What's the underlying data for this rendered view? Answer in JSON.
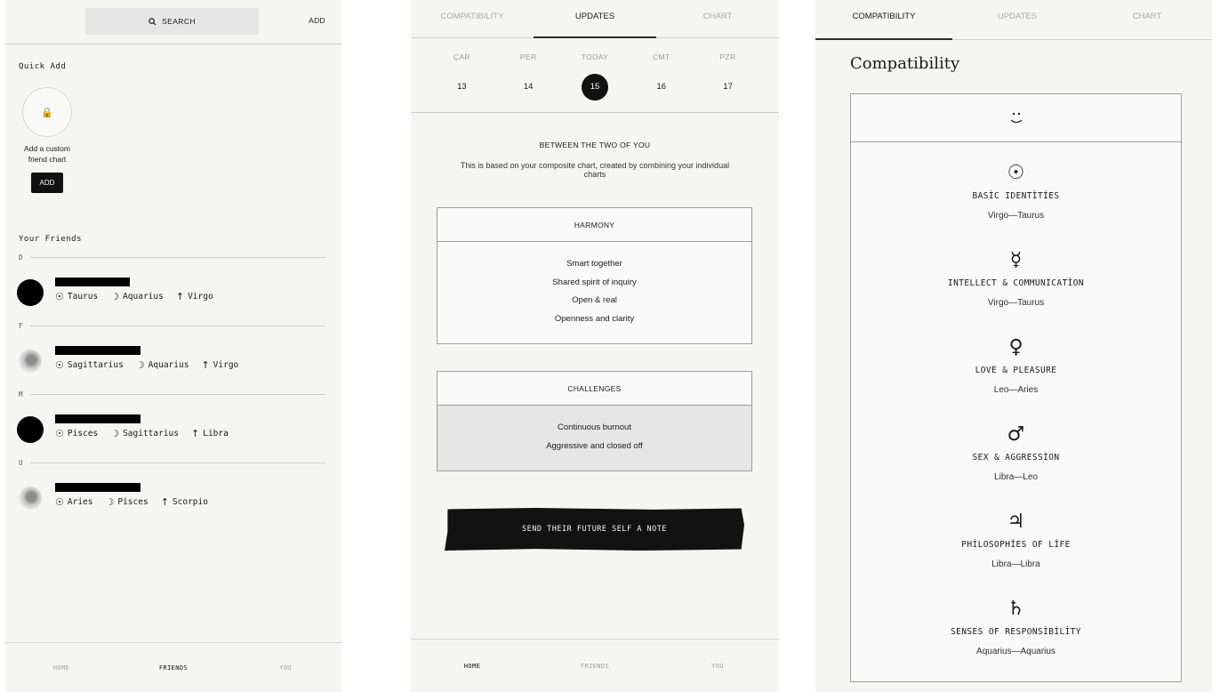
{
  "friends_screen": {
    "search_label": "SEARCH",
    "add_label": "ADD",
    "quick_add_label": "Quick Add",
    "custom_chart_text": "Add a custom friend chart",
    "custom_add_button": "ADD",
    "your_friends_label": "Your Friends",
    "groups": [
      {
        "letter": "D",
        "friend": {
          "sun": "Taurus",
          "moon": "Aquarius",
          "rising": "Virgo"
        }
      },
      {
        "letter": "F",
        "friend": {
          "sun": "Sagittarius",
          "moon": "Aquarius",
          "rising": "Virgo"
        }
      },
      {
        "letter": "M",
        "friend": {
          "sun": "Pisces",
          "moon": "Sagittarius",
          "rising": "Libra"
        }
      },
      {
        "letter": "U",
        "friend": {
          "sun": "Aries",
          "moon": "Pisces",
          "rising": "Scorpio"
        }
      }
    ],
    "nav": [
      "HOME",
      "FRIENDS",
      "YOU"
    ]
  },
  "updates_screen": {
    "tabs": [
      "COMPATIBILITY",
      "UPDATES",
      "CHART"
    ],
    "days": [
      {
        "name": "ÇAR",
        "num": "13"
      },
      {
        "name": "PER",
        "num": "14"
      },
      {
        "name": "TODAY",
        "num": "15"
      },
      {
        "name": "CMT",
        "num": "16"
      },
      {
        "name": "PZR",
        "num": "17"
      }
    ],
    "between_title": "BETWEEN THE TWO OF YOU",
    "between_sub": "This is based on your composite chart, created by combining your individual charts",
    "harmony_title": "HARMONY",
    "harmony_items": [
      "Smart together",
      "Shared spirit of inquiry",
      "Open & real",
      "Openness and clarity"
    ],
    "challenges_title": "CHALLENGES",
    "challenges_items": [
      "Continuous burnout",
      "Aggressive and closed off"
    ],
    "note_button": "SEND THEIR FUTURE SELF A NOTE",
    "nav": [
      "HOME",
      "FRIENDS",
      "YOU"
    ]
  },
  "compat_screen": {
    "tabs": [
      "COMPATIBILITY",
      "UPDATES",
      "CHART"
    ],
    "title": "Compatibility",
    "planets": [
      {
        "symbol": "☉",
        "icon": "sun-icon",
        "name": "BASİC IDENTİTİES",
        "value": "Virgo—Taurus"
      },
      {
        "symbol": "☿",
        "icon": "mercury-icon",
        "name": "INTELLECT & COMMUNICATİON",
        "value": "Virgo—Taurus"
      },
      {
        "symbol": "♀",
        "icon": "venus-icon",
        "name": "LOVE & PLEASURE",
        "value": "Leo—Aries"
      },
      {
        "symbol": "♂",
        "icon": "mars-icon",
        "name": "SEX & AGGRESSİON",
        "value": "Libra—Leo"
      },
      {
        "symbol": "♃",
        "icon": "jupiter-icon",
        "name": "PHİLOSOPHİES OF LİFE",
        "value": "Libra—Libra"
      },
      {
        "symbol": "♄",
        "icon": "saturn-icon",
        "name": "SENSES OF RESPONSİBİLİTY",
        "value": "Aquarius—Aquarius"
      }
    ]
  }
}
